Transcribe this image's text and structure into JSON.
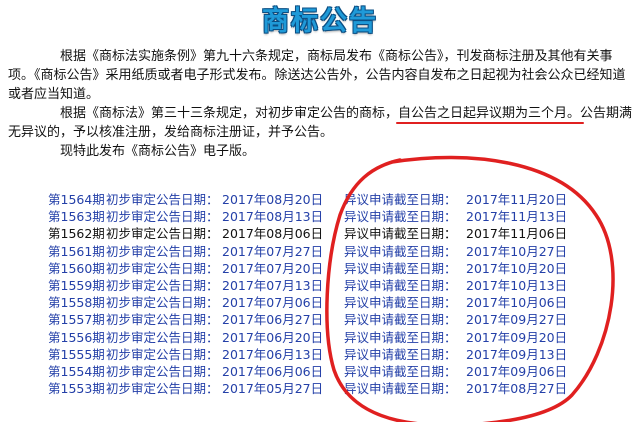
{
  "title": "商标公告",
  "intro": {
    "p1": "根据《商标法实施条例》第九十六条规定，商标局发布《商标公告》，刊发商标注册及其他有关事项。《商标公告》采用纸质或者电子形式发布。除送达公告外，公告内容自发布之日起视为社会公众已经知道或者应当知道。",
    "p2_before": "根据《商标法》第三十三条规定，对初步审定公告的商标，",
    "p2_highlight": "自公告之日起异议期为三个月。",
    "p2_after": "公告期满无异议的，予以核准注册，发给商标注册证，并予公告。",
    "p3": "现特此发布《商标公告》电子版。"
  },
  "table": {
    "rows": [
      {
        "period": "第1564期",
        "pub_label": "初步审定公告日期：",
        "pub_date": "2017年08月20日",
        "obj_label": "异议申请截至日期：",
        "obj_date": "2017年11月20日",
        "color": "blue"
      },
      {
        "period": "第1563期",
        "pub_label": "初步审定公告日期：",
        "pub_date": "2017年08月13日",
        "obj_label": "异议申请截至日期：",
        "obj_date": "2017年11月13日",
        "color": "blue"
      },
      {
        "period": "第1562期",
        "pub_label": "初步审定公告日期：",
        "pub_date": "2017年08月06日",
        "obj_label": "异议申请截至日期：",
        "obj_date": "2017年11月06日",
        "color": "black"
      },
      {
        "period": "第1561期",
        "pub_label": "初步审定公告日期：",
        "pub_date": "2017年07月27日",
        "obj_label": "异议申请截至日期：",
        "obj_date": "2017年10月27日",
        "color": "blue"
      },
      {
        "period": "第1560期",
        "pub_label": "初步审定公告日期：",
        "pub_date": "2017年07月20日",
        "obj_label": "异议申请截至日期：",
        "obj_date": "2017年10月20日",
        "color": "blue"
      },
      {
        "period": "第1559期",
        "pub_label": "初步审定公告日期：",
        "pub_date": "2017年07月13日",
        "obj_label": "异议申请截至日期：",
        "obj_date": "2017年10月13日",
        "color": "blue"
      },
      {
        "period": "第1558期",
        "pub_label": "初步审定公告日期：",
        "pub_date": "2017年07月06日",
        "obj_label": "异议申请截至日期：",
        "obj_date": "2017年10月06日",
        "color": "blue"
      },
      {
        "period": "第1557期",
        "pub_label": "初步审定公告日期：",
        "pub_date": "2017年06月27日",
        "obj_label": "异议申请截至日期：",
        "obj_date": "2017年09月27日",
        "color": "blue"
      },
      {
        "period": "第1556期",
        "pub_label": "初步审定公告日期：",
        "pub_date": "2017年06月20日",
        "obj_label": "异议申请截至日期：",
        "obj_date": "2017年09月20日",
        "color": "blue"
      },
      {
        "period": "第1555期",
        "pub_label": "初步审定公告日期：",
        "pub_date": "2017年06月13日",
        "obj_label": "异议申请截至日期：",
        "obj_date": "2017年09月13日",
        "color": "blue"
      },
      {
        "period": "第1554期",
        "pub_label": "初步审定公告日期：",
        "pub_date": "2017年06月06日",
        "obj_label": "异议申请截至日期：",
        "obj_date": "2017年09月06日",
        "color": "blue"
      },
      {
        "period": "第1553期",
        "pub_label": "初步审定公告日期：",
        "pub_date": "2017年05月27日",
        "obj_label": "异议申请截至日期：",
        "obj_date": "2017年08月27日",
        "color": "blue"
      }
    ]
  },
  "colors": {
    "title": "#1f9ad8",
    "link_blue": "#2440a8",
    "annotation_red": "#e02020",
    "text": "#111111"
  }
}
